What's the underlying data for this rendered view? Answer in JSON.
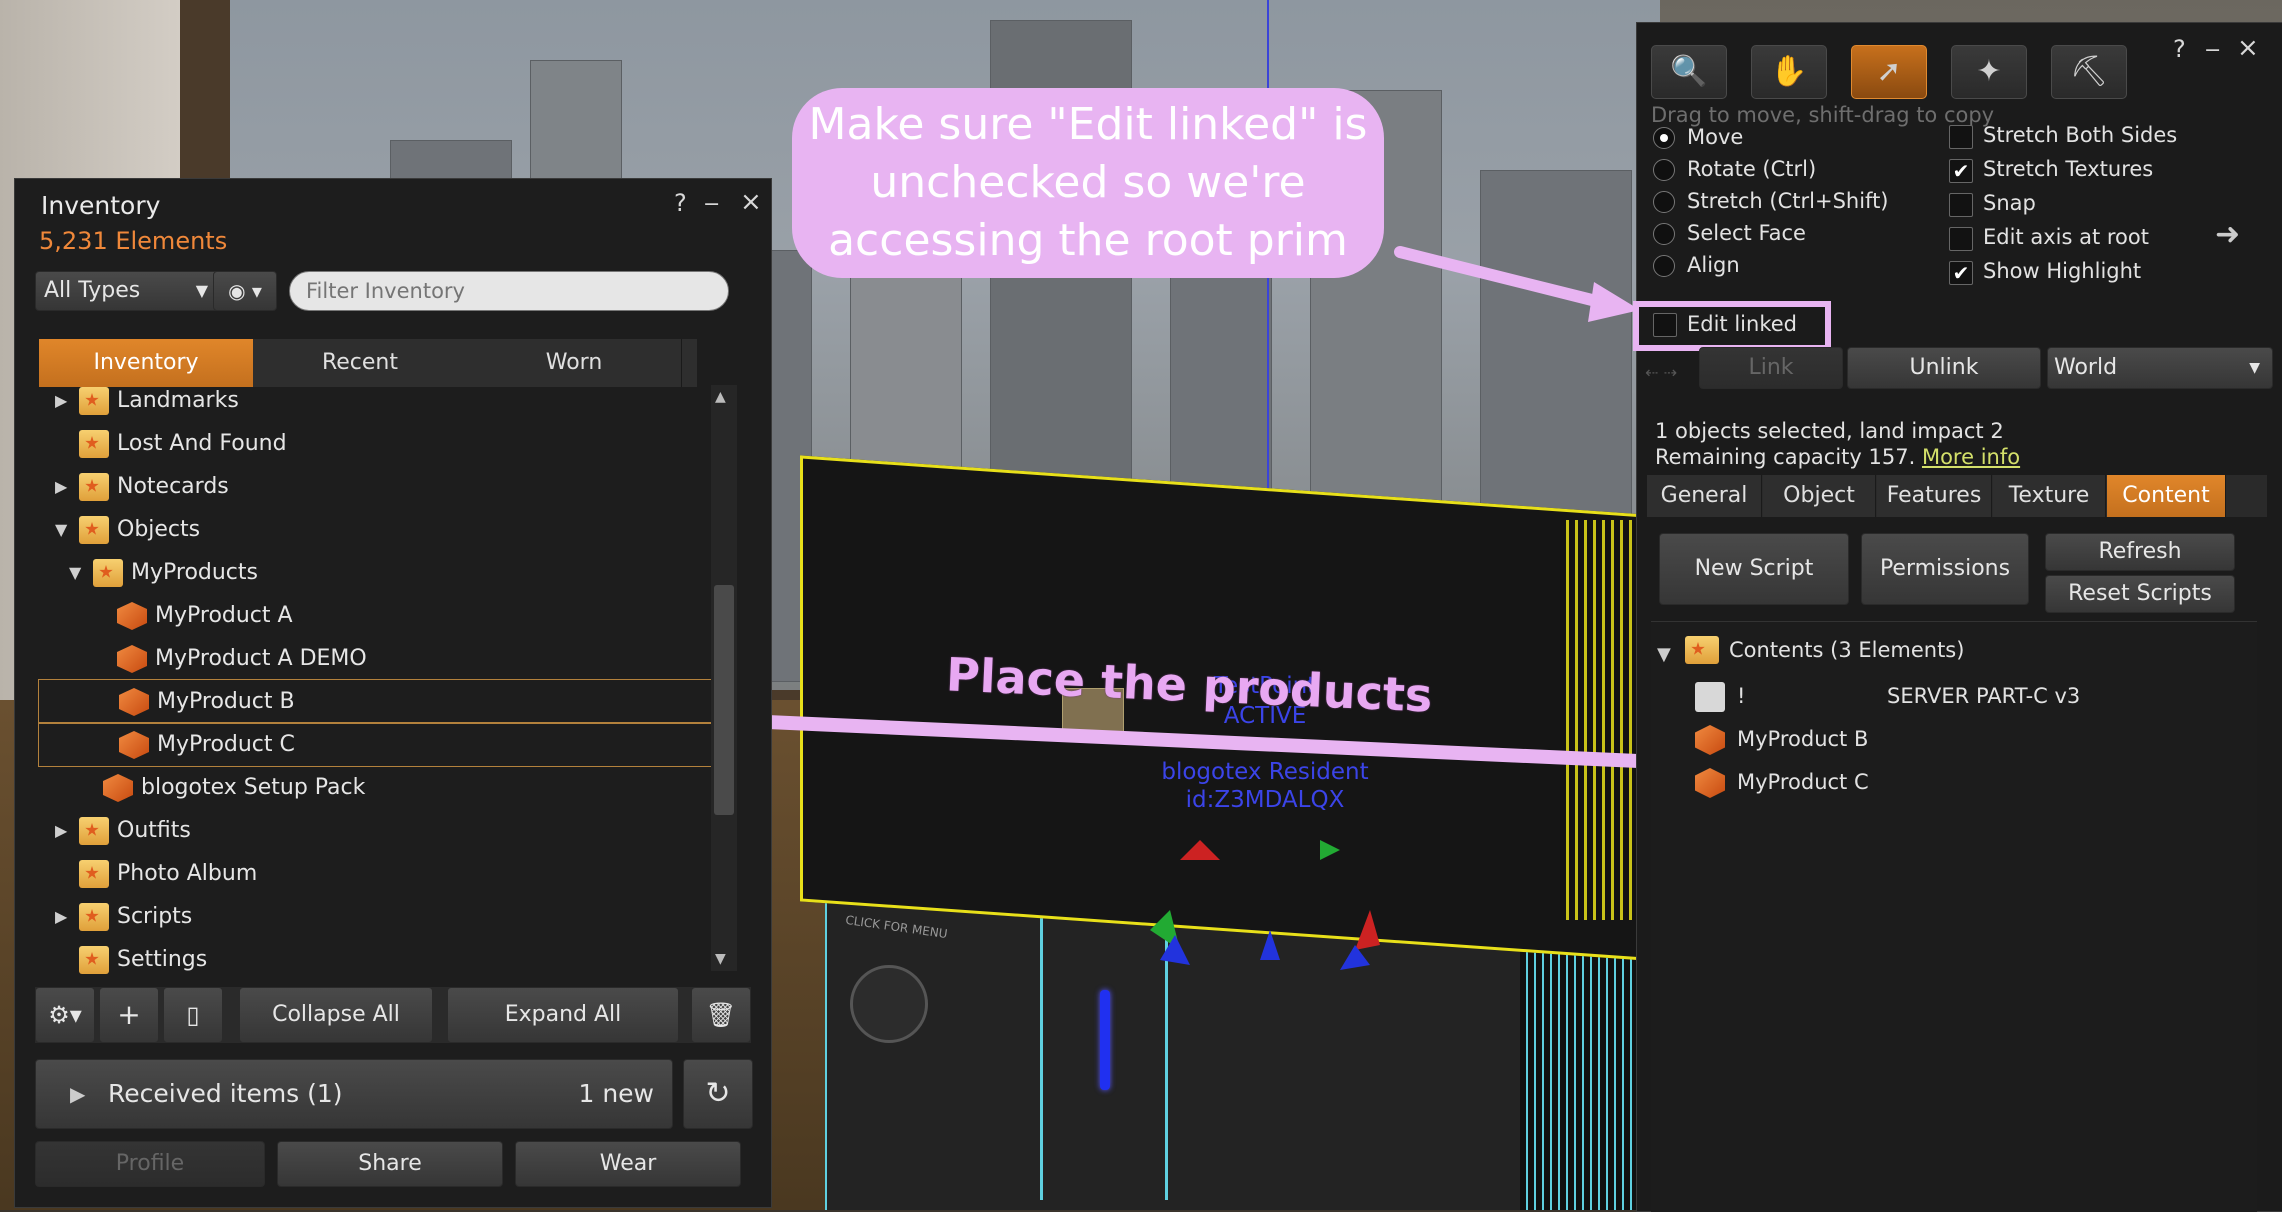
{
  "inventory": {
    "title": "Inventory",
    "count": "5,231 Elements",
    "type_filter": "All Types",
    "filter_placeholder": "Filter Inventory",
    "tabs": [
      "Inventory",
      "Recent",
      "Worn"
    ],
    "tree": [
      {
        "label": "Landmarks",
        "expander": "right",
        "icon": "landmark-folder-icon"
      },
      {
        "label": "Lost And Found",
        "expander": "",
        "icon": "lost-found-folder-icon"
      },
      {
        "label": "Notecards",
        "expander": "right",
        "icon": "notecard-folder-icon"
      },
      {
        "label": "Objects",
        "expander": "down",
        "icon": "open-folder-icon"
      },
      {
        "label": "MyProducts",
        "expander": "down",
        "icon": "open-folder-icon"
      },
      {
        "label": "MyProduct A",
        "expander": "",
        "icon": "object-icon"
      },
      {
        "label": "MyProduct A DEMO",
        "expander": "",
        "icon": "object-icon"
      },
      {
        "label": "MyProduct B",
        "expander": "",
        "icon": "object-icon"
      },
      {
        "label": "MyProduct C",
        "expander": "",
        "icon": "object-icon"
      },
      {
        "label": "blogotex Setup Pack",
        "expander": "",
        "icon": "object-icon"
      },
      {
        "label": "Outfits",
        "expander": "right",
        "icon": "outfits-folder-icon"
      },
      {
        "label": "Photo Album",
        "expander": "",
        "icon": "photo-folder-icon"
      },
      {
        "label": "Scripts",
        "expander": "right",
        "icon": "script-folder-icon"
      },
      {
        "label": "Settings",
        "expander": "",
        "icon": "settings-folder-icon"
      }
    ],
    "collapse_all": "Collapse All",
    "expand_all": "Expand All",
    "received_label": "Received items (1)",
    "received_new": "1 new",
    "profile_button": "Profile",
    "share_button": "Share",
    "wear_button": "Wear"
  },
  "build": {
    "hint": "Drag to move, shift-drag to copy",
    "modes": [
      "Move",
      "Rotate (Ctrl)",
      "Stretch (Ctrl+Shift)",
      "Select Face",
      "Align"
    ],
    "selected_mode": "Move",
    "options": [
      {
        "label": "Stretch Both Sides",
        "checked": false
      },
      {
        "label": "Stretch Textures",
        "checked": true
      },
      {
        "label": "Snap",
        "checked": false
      },
      {
        "label": "Edit axis at root",
        "checked": false
      },
      {
        "label": "Show Highlight",
        "checked": true
      }
    ],
    "edit_linked": "Edit linked",
    "link_button": "Link",
    "unlink_button": "Unlink",
    "ref_frame": "World",
    "selection_info": "1 objects selected, land impact 2",
    "remaining_capacity": "Remaining capacity 157.",
    "more_info": "More info",
    "tabs": [
      "General",
      "Object",
      "Features",
      "Texture",
      "Content"
    ],
    "active_tab": "Content",
    "new_script": "New Script",
    "permissions": "Permissions",
    "refresh": "Refresh",
    "reset_scripts": "Reset Scripts",
    "contents_header": "Contents (3 Elements)",
    "contents": [
      {
        "name": "!",
        "desc": "SERVER PART-C v3",
        "icon": "script-icon"
      },
      {
        "name": "MyProduct B",
        "desc": "",
        "icon": "object-icon"
      },
      {
        "name": "MyProduct C",
        "desc": "",
        "icon": "object-icon"
      }
    ]
  },
  "scene": {
    "hover_text_1": "TestPoint",
    "hover_text_2": "ACTIVE",
    "owner_line_1": "blogotex Resident",
    "owner_line_2": "id:Z3MDALQX",
    "panel_text": "CLICK FOR MENU"
  },
  "annotations": {
    "edit_linked_note": "Make sure \"Edit linked\" is unchecked so we're accessing the root prim",
    "place_products": "Place the products",
    "accent_color": "#e8b4f2"
  }
}
